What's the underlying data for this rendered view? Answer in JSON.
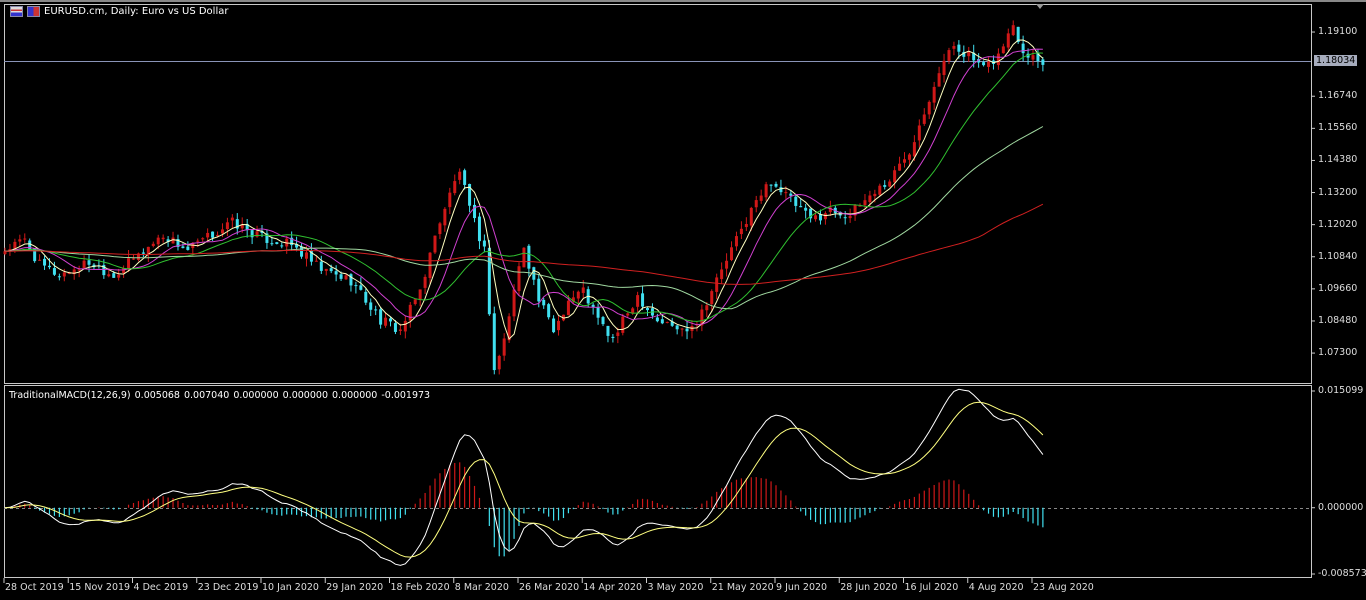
{
  "header": {
    "title": "EURUSD.cm, Daily:  Euro vs US Dollar"
  },
  "indicator": {
    "label": "TraditionalMACD(12,26,9)",
    "values": [
      "0.005068",
      "0.007040",
      "0.000000",
      "0.000000",
      "0.000000",
      "-0.001973"
    ]
  },
  "price_axis": {
    "ticks": [
      "1.19100",
      "1.16740",
      "1.15560",
      "1.14380",
      "1.13200",
      "1.12020",
      "1.10840",
      "1.09660",
      "1.08480",
      "1.07300"
    ],
    "current_price": "1.18034"
  },
  "macd_axis": {
    "ticks": [
      "0.015099",
      "0.000000",
      "-0.008573"
    ]
  },
  "time_axis": {
    "labels": [
      "28 Oct 2019",
      "15 Nov 2019",
      "4 Dec 2019",
      "23 Dec 2019",
      "10 Jan 2020",
      "29 Jan 2020",
      "18 Feb 2020",
      "8 Mar 2020",
      "26 Mar 2020",
      "14 Apr 2020",
      "3 May 2020",
      "21 May 2020",
      "9 Jun 2020",
      "28 Jun 2020",
      "16 Jul 2020",
      "4 Aug 2020",
      "23 Aug 2020"
    ]
  },
  "colors": {
    "bull": "#d01818",
    "bear": "#40e0f0",
    "ma": [
      "#ffffc0",
      "#d040d0",
      "#30c030",
      "#a0d8a0",
      "#d02020"
    ],
    "macd": "#ffffff",
    "signal": "#ffff80",
    "grid": "#c8c8c8",
    "price_line": "#8a94b8"
  },
  "chart_data": {
    "type": "candlestick",
    "symbol": "EURUSD.cm",
    "timeframe": "Daily",
    "bars": 211,
    "price_range": [
      1.062,
      1.2013
    ],
    "macd_range": [
      -0.008573,
      0.015099
    ],
    "close_anchors": [
      [
        0,
        1.1109
      ],
      [
        4,
        1.1145
      ],
      [
        7,
        1.1053
      ],
      [
        11,
        1.1017
      ],
      [
        17,
        1.1064
      ],
      [
        22,
        1.1017
      ],
      [
        27,
        1.109
      ],
      [
        32,
        1.1164
      ],
      [
        37,
        1.1109
      ],
      [
        46,
        1.1211
      ],
      [
        52,
        1.1153
      ],
      [
        58,
        1.1127
      ],
      [
        64,
        1.1035
      ],
      [
        70,
        1.0998
      ],
      [
        76,
        1.0851
      ],
      [
        80,
        1.0814
      ],
      [
        84,
        1.0961
      ],
      [
        88,
        1.1219
      ],
      [
        92,
        1.1403
      ],
      [
        94,
        1.1256
      ],
      [
        97,
        1.1109
      ],
      [
        99,
        1.0667
      ],
      [
        101,
        1.0778
      ],
      [
        103,
        1.0961
      ],
      [
        105,
        1.1127
      ],
      [
        108,
        1.0925
      ],
      [
        111,
        1.0814
      ],
      [
        114,
        1.0925
      ],
      [
        117,
        1.0961
      ],
      [
        120,
        1.0851
      ],
      [
        123,
        1.0778
      ],
      [
        128,
        1.0943
      ],
      [
        132,
        1.0851
      ],
      [
        137,
        1.0814
      ],
      [
        140,
        1.0851
      ],
      [
        143,
        1.0961
      ],
      [
        147,
        1.1109
      ],
      [
        151,
        1.1256
      ],
      [
        155,
        1.1366
      ],
      [
        159,
        1.1292
      ],
      [
        163,
        1.1219
      ],
      [
        167,
        1.1256
      ],
      [
        171,
        1.1237
      ],
      [
        175,
        1.1311
      ],
      [
        179,
        1.1366
      ],
      [
        183,
        1.1476
      ],
      [
        186,
        1.1623
      ],
      [
        189,
        1.177
      ],
      [
        192,
        1.1862
      ],
      [
        195,
        1.1825
      ],
      [
        198,
        1.177
      ],
      [
        201,
        1.1825
      ],
      [
        204,
        1.1936
      ],
      [
        206,
        1.1844
      ],
      [
        210,
        1.1803
      ]
    ],
    "moving_averages": [
      5,
      10,
      20,
      50,
      100
    ],
    "macd_params": [
      12,
      26,
      9
    ]
  }
}
